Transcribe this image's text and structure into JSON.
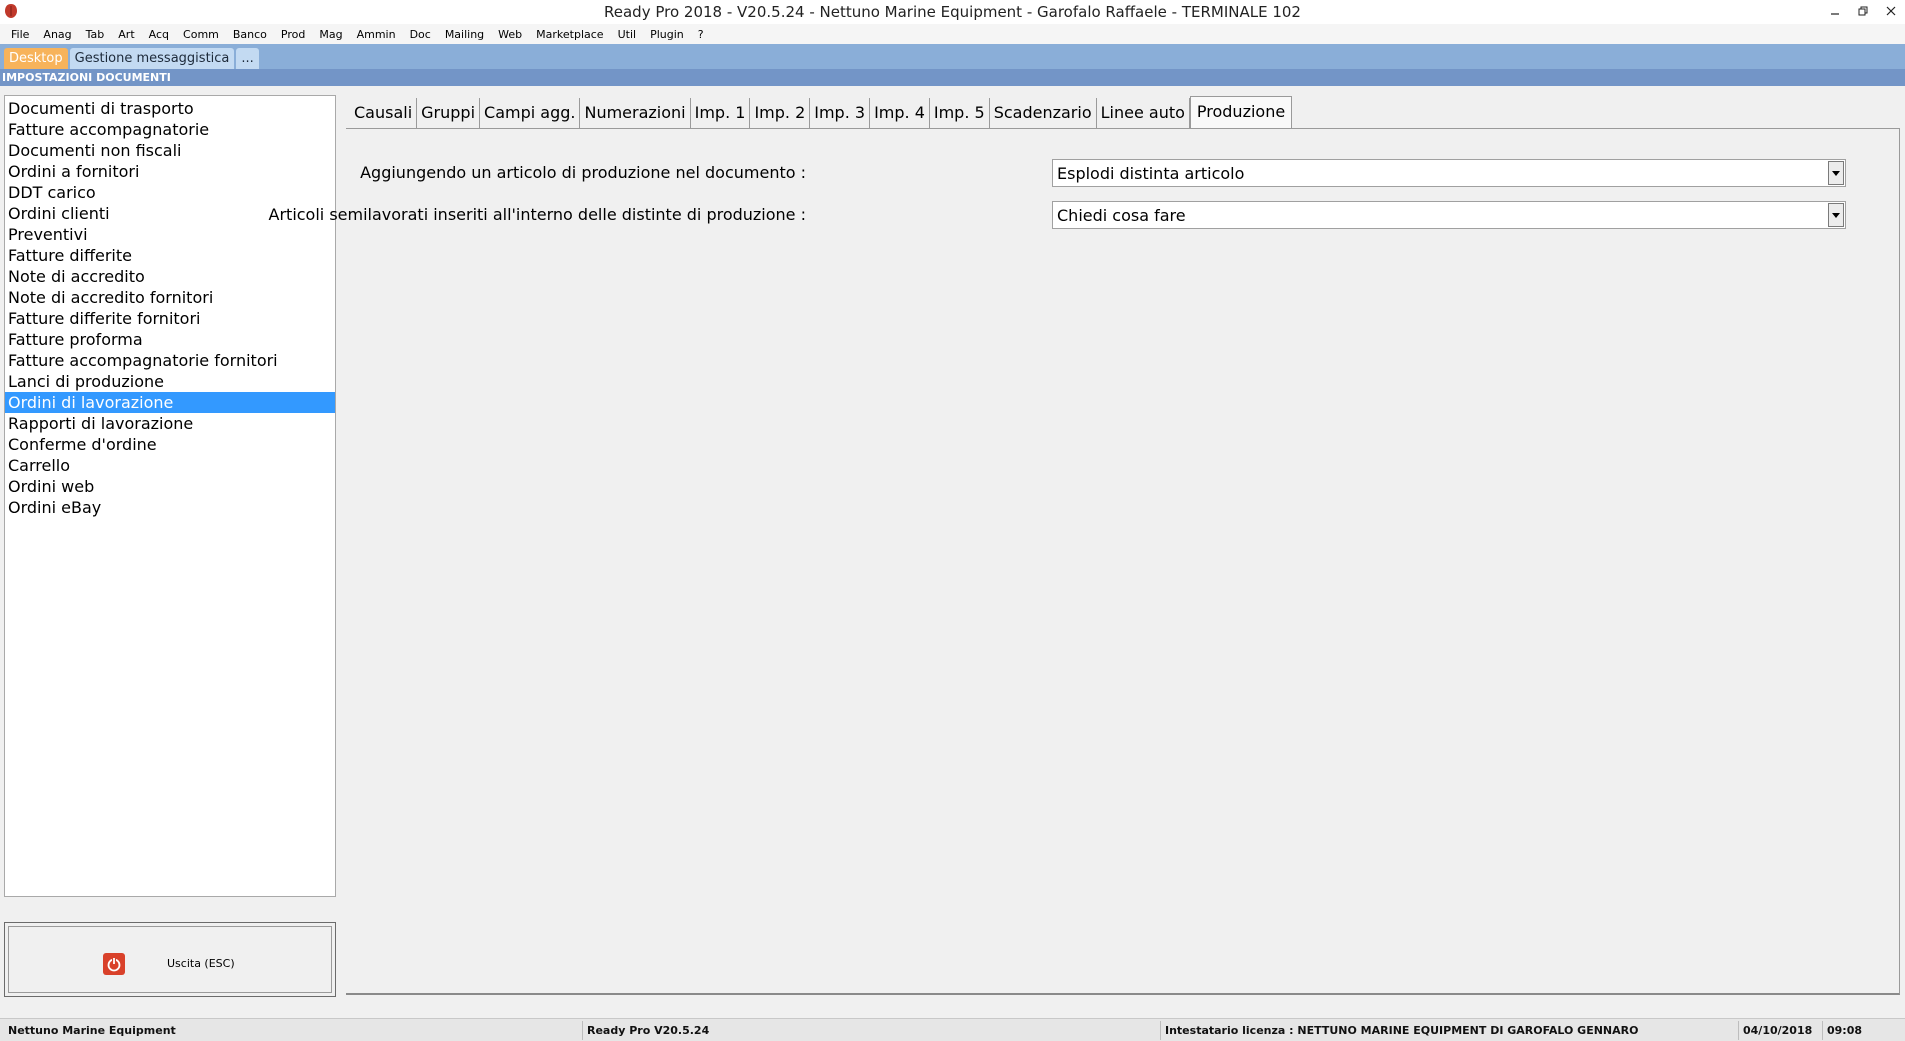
{
  "window": {
    "title": "Ready Pro 2018 - V20.5.24 - Nettuno Marine Equipment - Garofalo Raffaele - TERMINALE 102"
  },
  "menu": [
    "File",
    "Anag",
    "Tab",
    "Art",
    "Acq",
    "Comm",
    "Banco",
    "Prod",
    "Mag",
    "Ammin",
    "Doc",
    "Mailing",
    "Web",
    "Marketplace",
    "Util",
    "Plugin",
    "?"
  ],
  "desktop_tabs": {
    "desktop": "Desktop",
    "messaging": "Gestione messaggistica",
    "more": "..."
  },
  "section_header": "IMPOSTAZIONI DOCUMENTI",
  "doc_list": {
    "items": [
      "Documenti di trasporto",
      "Fatture accompagnatorie",
      "Documenti non fiscali",
      "Ordini a fornitori",
      "DDT carico",
      "Ordini clienti",
      "Preventivi",
      "Fatture differite",
      "Note di accredito",
      "Note di accredito fornitori",
      "Fatture differite fornitori",
      "Fatture proforma",
      "Fatture accompagnatorie fornitori",
      "Lanci di produzione",
      "Ordini di lavorazione",
      "Rapporti di lavorazione",
      "Conferme d'ordine",
      "Carrello",
      "Ordini web",
      "Ordini eBay"
    ],
    "selected_index": 14
  },
  "exit_button": {
    "label": "Uscita (ESC)",
    "icon": "power-icon"
  },
  "tabs": {
    "items": [
      "Causali",
      "Gruppi",
      "Campi agg.",
      "Numerazioni",
      "Imp. 1",
      "Imp. 2",
      "Imp. 3",
      "Imp. 4",
      "Imp. 5",
      "Scadenzario",
      "Linee auto",
      "Produzione"
    ],
    "active_index": 11
  },
  "production": {
    "row1": {
      "label": "Aggiungendo un articolo di produzione nel documento :",
      "value": "Esplodi distinta articolo"
    },
    "row2": {
      "label": "Articoli semilavorati inseriti all'interno delle distinte di produzione :",
      "value": "Chiedi cosa fare"
    }
  },
  "statusbar": {
    "company": "Nettuno Marine Equipment",
    "version": "Ready Pro V20.5.24",
    "license": "Intestatario licenza : NETTUNO MARINE EQUIPMENT DI GAROFALO GENNARO",
    "date": "04/10/2018",
    "time": "09:08"
  },
  "colors": {
    "accent_tab": "#f7b35b",
    "tabbar": "#8aaed8",
    "section_header": "#7395c7",
    "selection": "#3399ff"
  }
}
